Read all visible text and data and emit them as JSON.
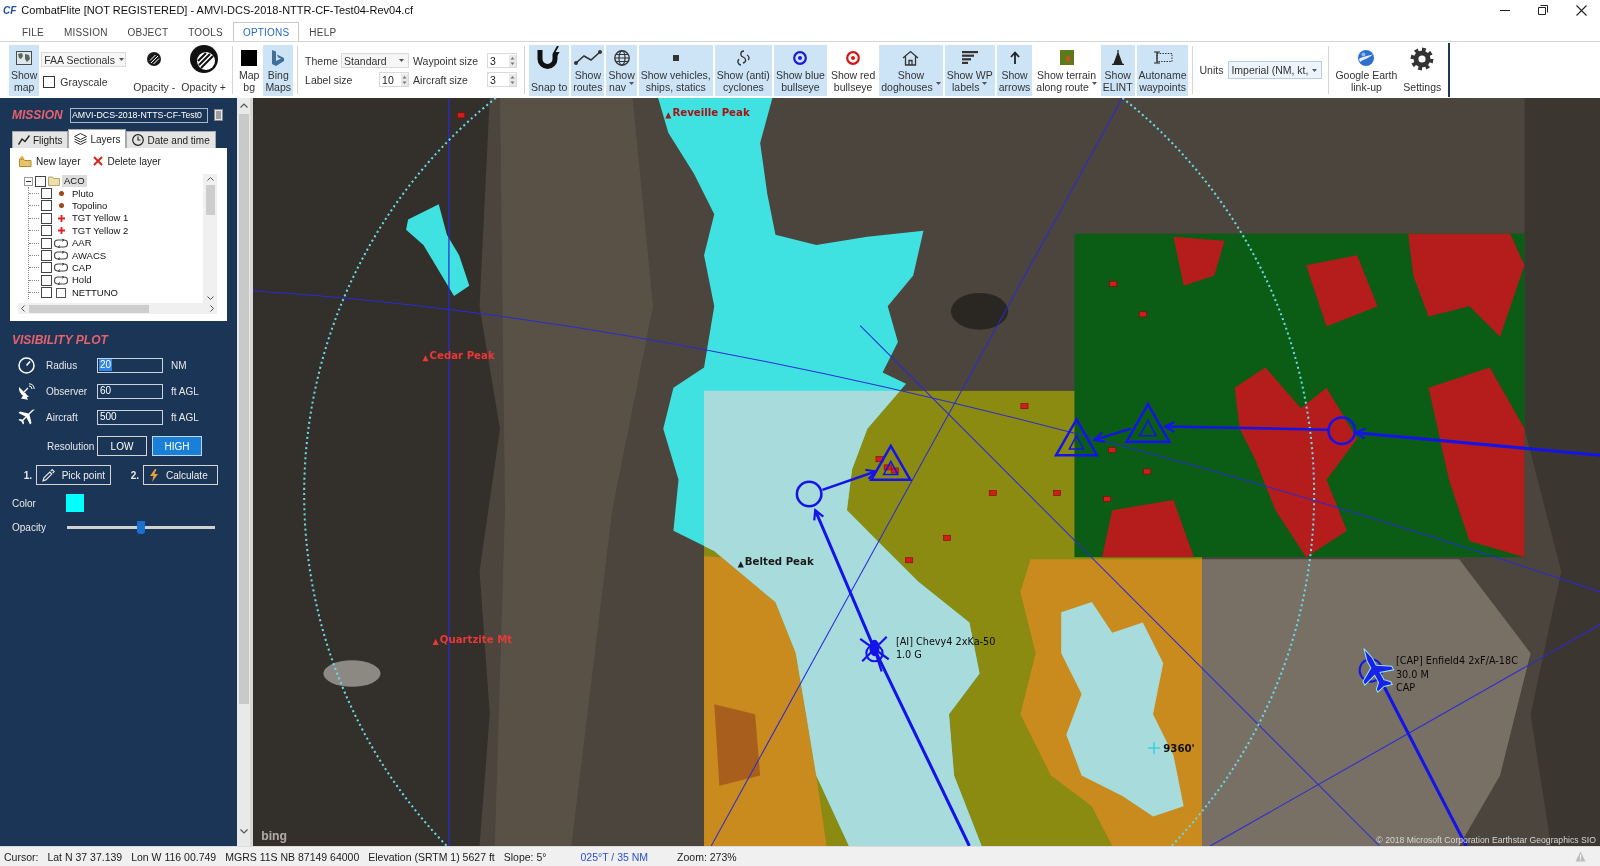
{
  "window": {
    "app_mark": "CF",
    "title": "CombatFlite [NOT REGISTERED] - AMVI-DCS-2018-NTTR-CF-Test04-Rev04.cf"
  },
  "menu": [
    {
      "label": "FILE",
      "selected": false
    },
    {
      "label": "MISSION",
      "selected": false
    },
    {
      "label": "OBJECT",
      "selected": false
    },
    {
      "label": "TOOLS",
      "selected": false
    },
    {
      "label": "OPTIONS",
      "selected": true
    },
    {
      "label": "HELP",
      "selected": false
    }
  ],
  "ribbon": [
    {
      "kind": "button",
      "lines": [
        "Show",
        "map"
      ],
      "on": true,
      "menu": false
    },
    {
      "kind": "map-source",
      "value": "FAA Sectionals",
      "option": "Grayscale",
      "checked": false
    },
    {
      "kind": "button",
      "lines": [
        "Opacity -"
      ],
      "on": false,
      "menu": false
    },
    {
      "kind": "button",
      "lines": [
        "Opacity +"
      ],
      "on": false,
      "menu": false
    },
    {
      "kind": "separator"
    },
    {
      "kind": "button",
      "lines": [
        "Map",
        "bg"
      ],
      "on": false,
      "menu": false
    },
    {
      "kind": "button",
      "lines": [
        "Bing",
        "Maps"
      ],
      "on": true,
      "menu": false
    },
    {
      "kind": "separator"
    },
    {
      "kind": "sizes",
      "fields": [
        {
          "kind": "select",
          "label": "Theme",
          "value": "Standard"
        },
        {
          "kind": "spinner",
          "label": "Waypoint size",
          "value": "3"
        },
        {
          "kind": "spinner",
          "label": "Label size",
          "value": "10"
        },
        {
          "kind": "spinner",
          "label": "Aircraft size",
          "value": "3"
        }
      ]
    },
    {
      "kind": "separator"
    },
    {
      "kind": "button",
      "lines": [
        "Snap to"
      ],
      "on": true,
      "menu": false
    },
    {
      "kind": "button",
      "lines": [
        "Show",
        "routes"
      ],
      "on": true,
      "menu": false
    },
    {
      "kind": "button",
      "lines": [
        "Show",
        "nav"
      ],
      "on": true,
      "menu": true
    },
    {
      "kind": "button",
      "lines": [
        "Show vehicles,",
        "ships, statics"
      ],
      "on": true,
      "menu": false
    },
    {
      "kind": "button",
      "lines": [
        "Show (anti)",
        "cyclones"
      ],
      "on": true,
      "menu": false
    },
    {
      "kind": "button",
      "lines": [
        "Show blue",
        "bullseye"
      ],
      "on": true,
      "menu": false
    },
    {
      "kind": "button",
      "lines": [
        "Show red",
        "bullseye"
      ],
      "on": false,
      "menu": false
    },
    {
      "kind": "button",
      "lines": [
        "Show",
        "doghouses"
      ],
      "on": true,
      "menu": true
    },
    {
      "kind": "button",
      "lines": [
        "Show WP",
        "labels"
      ],
      "on": true,
      "menu": true
    },
    {
      "kind": "button",
      "lines": [
        "Show",
        "arrows"
      ],
      "on": true,
      "menu": false
    },
    {
      "kind": "button",
      "lines": [
        "Show terrain",
        "along route"
      ],
      "on": false,
      "menu": true
    },
    {
      "kind": "button",
      "lines": [
        "Show",
        "ELINT"
      ],
      "on": true,
      "menu": false
    },
    {
      "kind": "button",
      "lines": [
        "Autoname",
        "waypoints"
      ],
      "on": true,
      "menu": false
    },
    {
      "kind": "separator"
    },
    {
      "kind": "units",
      "label": "Units",
      "value": "Imperial (NM, kt,"
    },
    {
      "kind": "separator"
    },
    {
      "kind": "button",
      "lines": [
        "Google Earth",
        "link-up"
      ],
      "on": false,
      "menu": false
    },
    {
      "kind": "button",
      "lines": [
        "Settings"
      ],
      "on": false,
      "menu": false
    },
    {
      "kind": "edge"
    }
  ],
  "mission": {
    "heading": "MISSION",
    "name": "AMVI-DCS-2018-NTTS-CF-Test0"
  },
  "panel_tabs": [
    {
      "label": "Flights",
      "selected": false
    },
    {
      "label": "Layers",
      "selected": true
    },
    {
      "label": "Date and time",
      "selected": false
    }
  ],
  "layers": {
    "actions": [
      {
        "label": "New layer"
      },
      {
        "label": "Delete layer"
      }
    ],
    "tree": [
      {
        "label": "ACO",
        "kind": "folder",
        "checked": false,
        "selected": true,
        "expanded": true,
        "children": [
          {
            "label": "Pluto",
            "kind": "point",
            "checked": false,
            "selected": false
          },
          {
            "label": "Topolino",
            "kind": "point",
            "checked": false,
            "selected": false
          },
          {
            "label": "TGT Yellow 1",
            "kind": "target",
            "checked": false,
            "selected": false
          },
          {
            "label": "TGT Yellow 2",
            "kind": "target",
            "checked": false,
            "selected": false
          },
          {
            "label": "AAR",
            "kind": "orbit",
            "checked": false,
            "selected": false
          },
          {
            "label": "AWACS",
            "kind": "orbit",
            "checked": false,
            "selected": false
          },
          {
            "label": "CAP",
            "kind": "orbit",
            "checked": false,
            "selected": false
          },
          {
            "label": "Hold",
            "kind": "orbit",
            "checked": false,
            "selected": false
          },
          {
            "label": "NETTUNO",
            "kind": "area",
            "checked": false,
            "selected": false
          }
        ]
      }
    ]
  },
  "visibility_plot": {
    "heading": "VISIBILITY PLOT",
    "fields": [
      {
        "label": "Radius",
        "value": "20",
        "unit": "NM",
        "highlighted": true
      },
      {
        "label": "Observer",
        "value": "60",
        "unit": "ft AGL",
        "highlighted": false
      },
      {
        "label": "Aircraft",
        "value": "500",
        "unit": "ft AGL",
        "highlighted": false
      }
    ],
    "resolution": {
      "label": "Resolution",
      "options": [
        {
          "label": "LOW",
          "selected": false
        },
        {
          "label": "HIGH",
          "selected": true
        }
      ]
    },
    "steps": [
      {
        "number": "1.",
        "label": "Pick point"
      },
      {
        "number": "2.",
        "label": "Calculate"
      }
    ],
    "color": {
      "label": "Color",
      "color": "#00ffff"
    },
    "opacity": {
      "label": "Opacity",
      "level": 0.5
    }
  },
  "map": {
    "place_labels": [
      {
        "label": "Reveille Peak",
        "color": "#a31515"
      },
      {
        "label": "Cedar Peak",
        "color": "#e83838"
      },
      {
        "label": "Belted Peak",
        "color": "#1a1a1a"
      },
      {
        "label": "Quartzite Mt",
        "color": "#e83838"
      }
    ],
    "flights": [
      {
        "kind": "helicopter",
        "label": "[AI] Chevy4 2xKa-50",
        "details": [
          "1.0 G"
        ]
      },
      {
        "kind": "jet",
        "label": "[CAP] Enfield4 2xF/A-18C",
        "details": [
          "30.0 M",
          "CAP"
        ]
      }
    ],
    "spot_heights": [
      "9360'"
    ],
    "attribution": "bing",
    "copyright": "© 2018 Microsoft Corporation Earthstar Geographics SIO"
  },
  "status_bar": [
    {
      "kind": "plain",
      "text": "Cursor:"
    },
    {
      "kind": "plain",
      "text": "Lat N 37 37.139"
    },
    {
      "kind": "plain",
      "text": "Lon W 116 00.749"
    },
    {
      "kind": "plain",
      "text": "MGRS 11S NB 87149 64000"
    },
    {
      "kind": "plain",
      "text": "Elevation (SRTM 1) 5627 ft"
    },
    {
      "kind": "plain",
      "text": "Slope: 5°"
    },
    {
      "kind": "bearing",
      "text": "025°T / 35 NM"
    },
    {
      "kind": "plain",
      "text": "Zoom: 273%"
    }
  ]
}
